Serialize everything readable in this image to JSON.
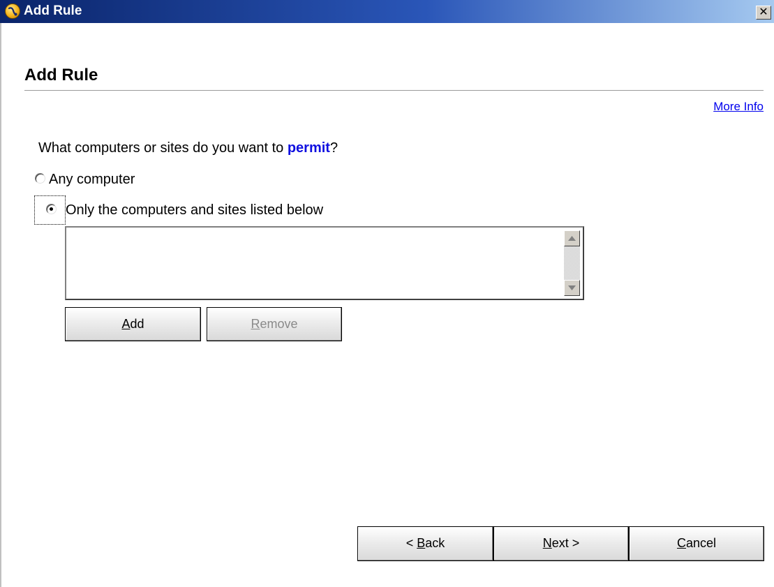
{
  "window": {
    "title": "Add Rule",
    "close_glyph": "✕"
  },
  "page": {
    "heading": "Add Rule",
    "more_info_link": "More Info"
  },
  "question": {
    "prefix": "What computers or sites do you want to ",
    "emphasis": "permit",
    "suffix": "?"
  },
  "options": [
    {
      "label": "Any computer",
      "selected": false
    },
    {
      "label": "Only the computers and sites listed below",
      "selected": true
    }
  ],
  "site_list": {
    "items": []
  },
  "list_buttons": {
    "add": {
      "mnemonic": "A",
      "rest": "dd"
    },
    "remove": {
      "mnemonic": "R",
      "rest": "emove",
      "enabled": false
    }
  },
  "footer_buttons": {
    "back": {
      "prefix": "< ",
      "mnemonic": "B",
      "rest": "ack"
    },
    "next": {
      "mnemonic": "N",
      "rest": "ext >"
    },
    "cancel": {
      "mnemonic": "C",
      "rest": "ancel"
    }
  },
  "colors": {
    "titlebar_start": "#0a246a",
    "titlebar_end": "#a6caf0",
    "link": "#0000ee",
    "emphasis": "#1010e0"
  },
  "icons": {
    "window_icon": "firewall-shield-icon",
    "close": "close-icon",
    "scroll_up": "scroll-up-arrow-icon",
    "scroll_down": "scroll-down-arrow-icon"
  }
}
